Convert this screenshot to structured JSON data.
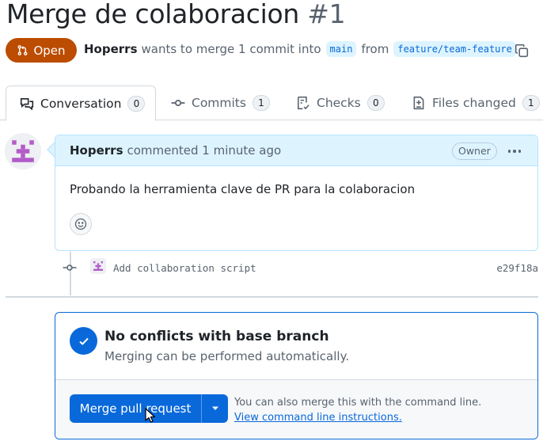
{
  "pull_request": {
    "title": "Merge de colaboracion",
    "number": "#1",
    "state": "Open",
    "author": "Hoperrs",
    "summary": "wants to merge 1 commit into",
    "base_branch": "main",
    "from_text": "from",
    "head_branch": "feature/team-feature"
  },
  "tabs": [
    {
      "label": "Conversation",
      "count": "0",
      "icon": "comment-discussion-icon"
    },
    {
      "label": "Commits",
      "count": "1",
      "icon": "git-commit-icon"
    },
    {
      "label": "Checks",
      "count": "0",
      "icon": "checklist-icon"
    },
    {
      "label": "Files changed",
      "count": "1",
      "icon": "file-diff-icon"
    }
  ],
  "comment": {
    "author": "Hoperrs",
    "action": "commented",
    "time": "1 minute ago",
    "role_badge": "Owner",
    "body": "Probando la herramienta clave de PR para la colaboracion"
  },
  "commit": {
    "message": "Add collaboration script",
    "sha": "e29f18a"
  },
  "merge": {
    "status_title": "No conflicts with base branch",
    "status_subtitle": "Merging can be performed automatically.",
    "button_label": "Merge pull request",
    "cli_text": "You can also merge this with the command line.",
    "cli_link": "View command line instructions."
  },
  "colors": {
    "open_badge": "#bc4c00",
    "primary_blue": "#0969da",
    "comment_header": "#ddf4ff",
    "avatar_purple": "#b35bc8"
  }
}
